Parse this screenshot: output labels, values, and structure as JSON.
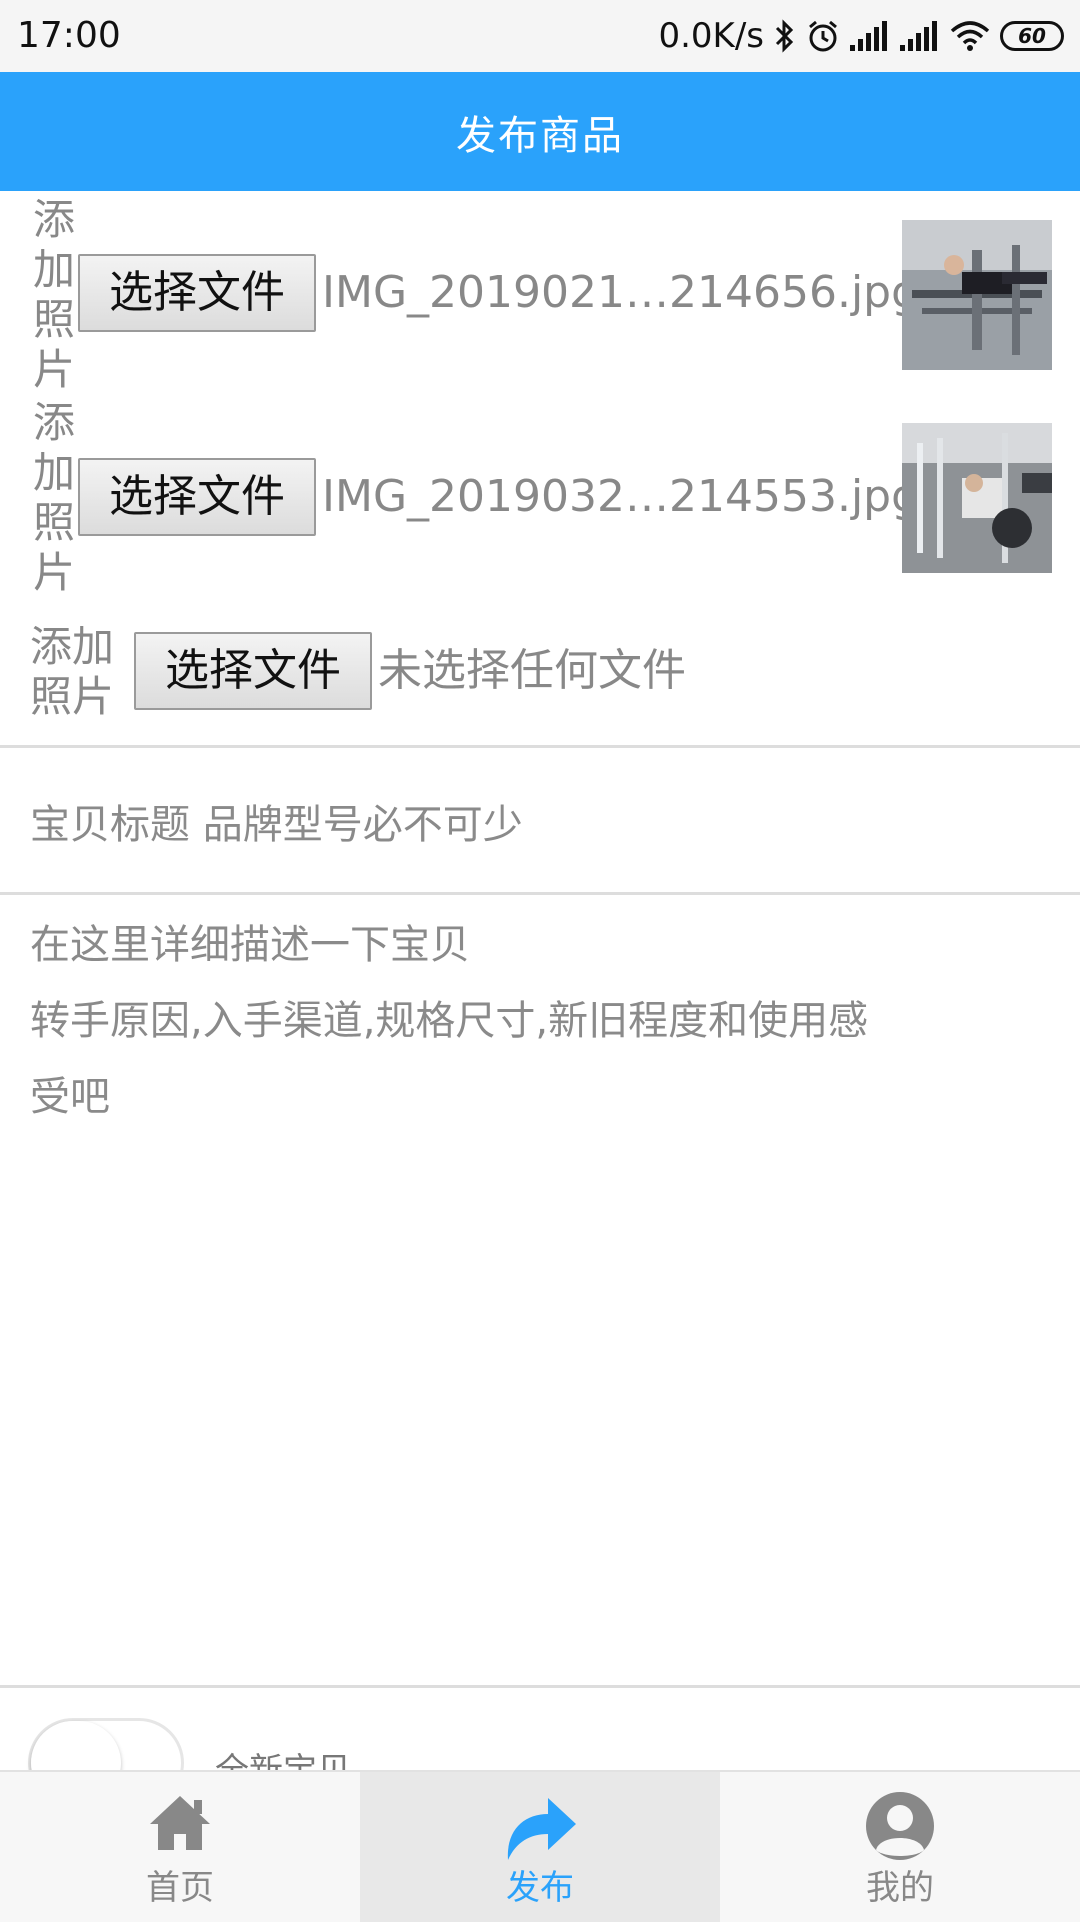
{
  "status_bar": {
    "time": "17:00",
    "net_speed": "0.0K/s",
    "battery": "60",
    "icons": [
      "bluetooth-icon",
      "alarm-icon",
      "signal-icon",
      "signal-icon",
      "wifi-icon",
      "battery-icon"
    ]
  },
  "header": {
    "title": "发布商品"
  },
  "uploads": [
    {
      "label_chars": [
        "添",
        "加",
        "照",
        "片"
      ],
      "button": "选择文件",
      "file_name": "IMG_2019021…214656.jpg",
      "has_thumbnail": true
    },
    {
      "label_chars": [
        "添",
        "加",
        "照",
        "片"
      ],
      "button": "选择文件",
      "file_name": "IMG_2019032…214553.jpg",
      "has_thumbnail": true
    },
    {
      "label_lines": [
        "添加",
        "照片"
      ],
      "button": "选择文件",
      "file_name": "未选择任何文件",
      "has_thumbnail": false
    }
  ],
  "form": {
    "title_placeholder": "宝贝标题 品牌型号必不可少",
    "description_placeholder_lines": [
      "在这里详细描述一下宝贝",
      "转手原因,入手渠道,规格尺寸,新旧程度和使用感",
      "受吧"
    ],
    "new_item_label": "全新宝贝"
  },
  "bottom_nav": {
    "items": [
      {
        "label": "首页",
        "icon": "home-icon",
        "active": false
      },
      {
        "label": "发布",
        "icon": "share-arrow-icon",
        "active": true
      },
      {
        "label": "我的",
        "icon": "user-icon",
        "active": false
      }
    ],
    "accent_color": "#2aa2fb"
  }
}
